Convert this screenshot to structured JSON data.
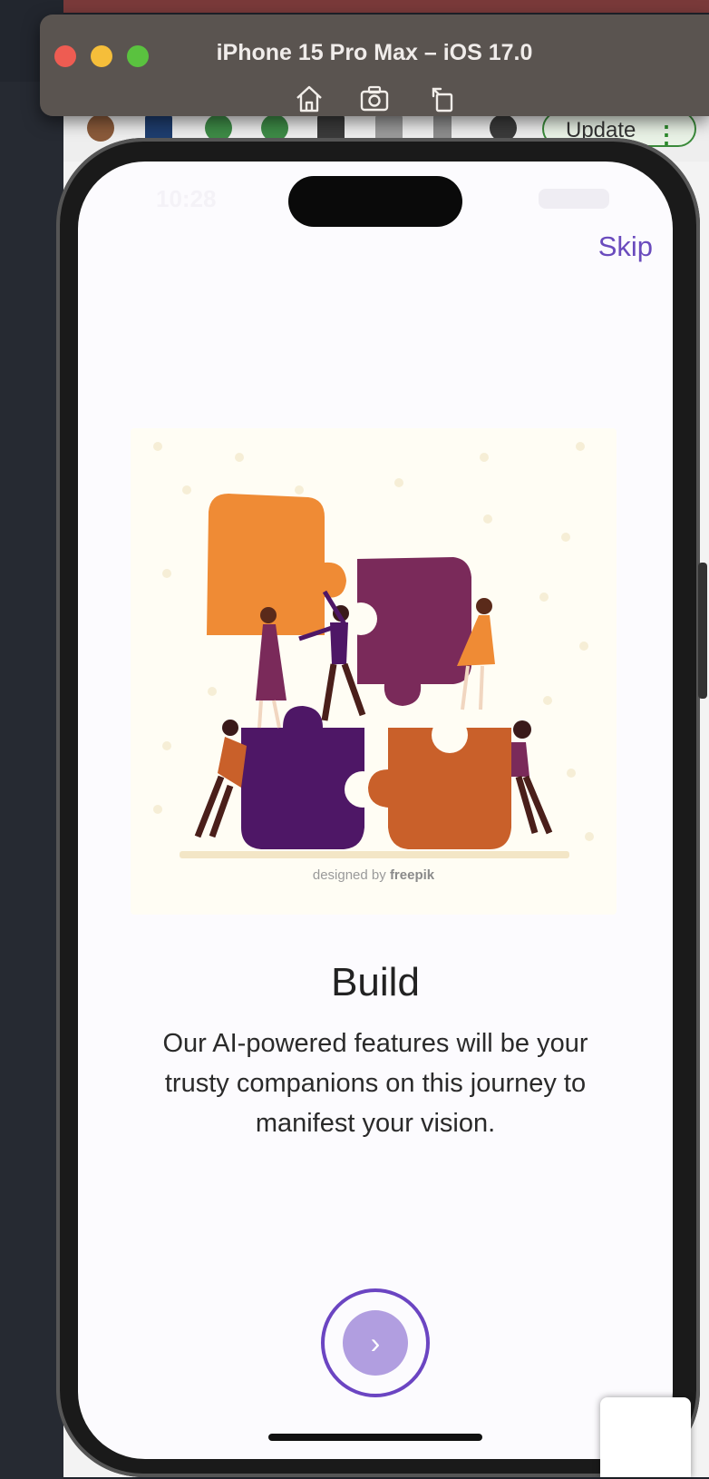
{
  "simulator": {
    "title": "iPhone 15 Pro Max – iOS 17.0",
    "tools": [
      "home-icon",
      "screenshot-icon",
      "rotate-icon"
    ]
  },
  "browser": {
    "update_label": "Update"
  },
  "status_bar": {
    "time": "10:28"
  },
  "onboarding": {
    "skip_label": "Skip",
    "illustration_credit_prefix": "designed by",
    "illustration_credit_brand": "freepik",
    "title": "Build",
    "description": "Our AI-powered features will be your trusty companions on this journey to manifest your vision.",
    "next_symbol": "›"
  },
  "colors": {
    "accent": "#6b45c2",
    "next_fill": "#b19ee0",
    "puzzle_orange": "#ef8b35",
    "puzzle_plum": "#7a2a5a",
    "puzzle_purple": "#4e1766",
    "puzzle_rust": "#c9602a"
  }
}
